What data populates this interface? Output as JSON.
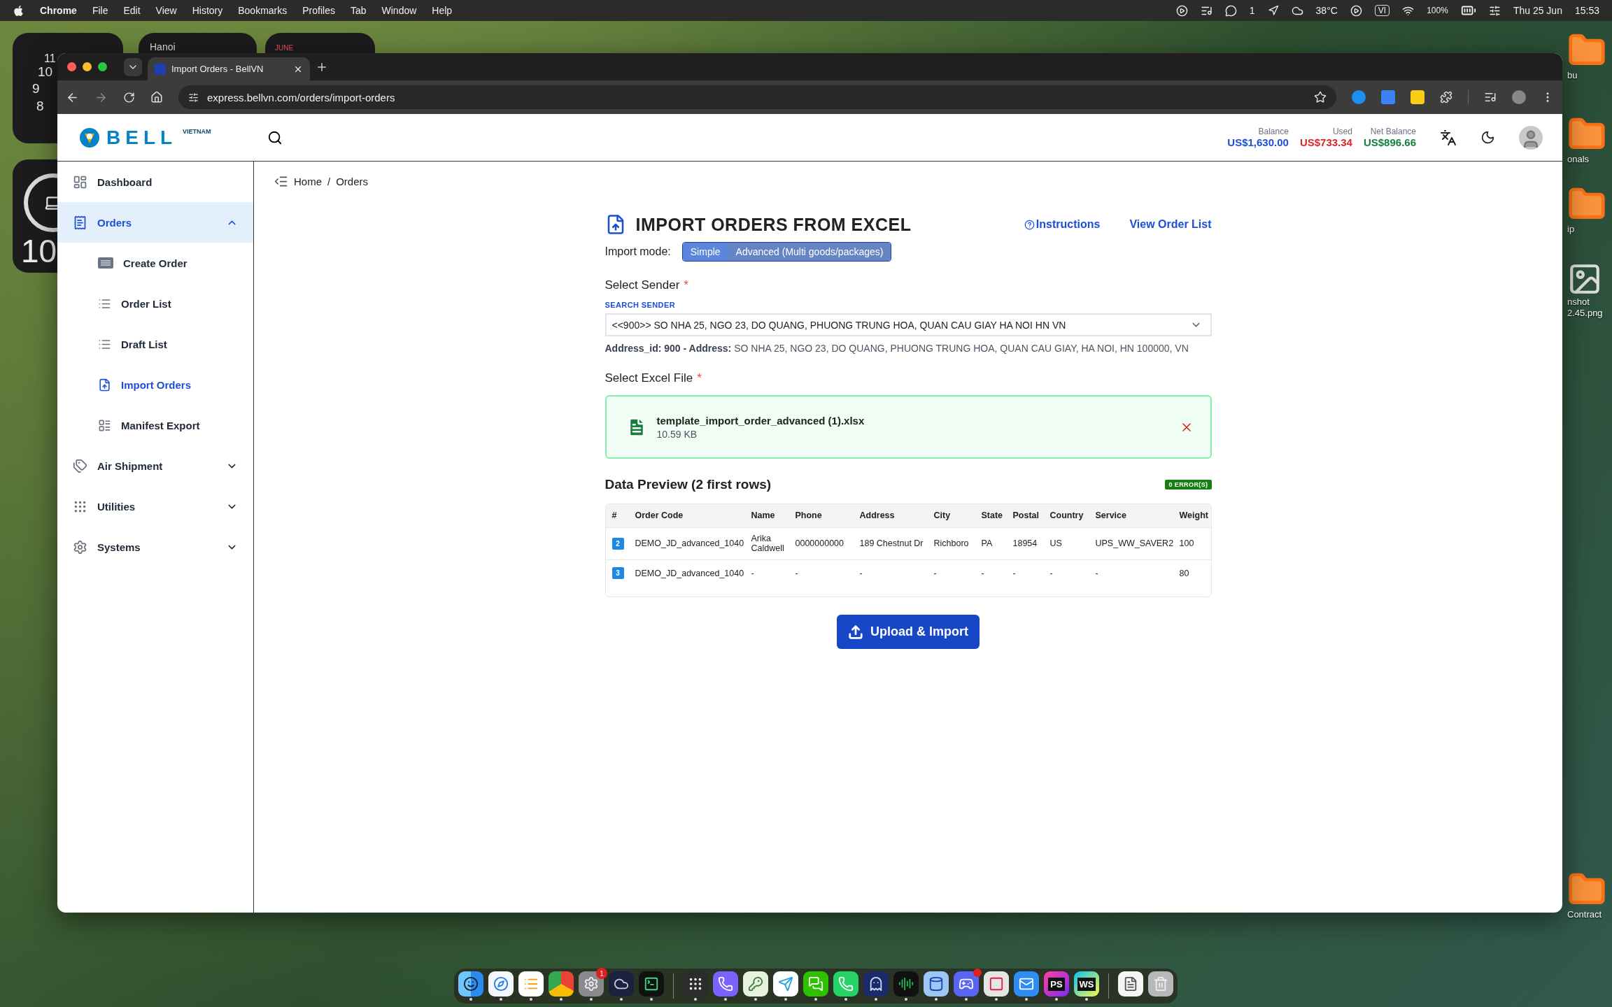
{
  "menu_bar": {
    "app": "Chrome",
    "menus": [
      "File",
      "Edit",
      "View",
      "History",
      "Bookmarks",
      "Profiles",
      "Tab",
      "Window",
      "Help"
    ],
    "chat_count": "1",
    "weather": "38°C",
    "input_source": "VI",
    "battery": "100%",
    "date": "Thu 25 Jun",
    "time": "15:53"
  },
  "desktop": {
    "clock_numerals": [
      "11",
      "10",
      "9",
      "8"
    ],
    "weather_city": "Hanoi",
    "calendar_month": "JUNE",
    "device_battery": "10",
    "icons": [
      {
        "kind": "folder",
        "lines": [
          "bu"
        ]
      },
      {
        "kind": "folder",
        "lines": [
          "onals"
        ]
      },
      {
        "kind": "folder",
        "lines": [
          "ip"
        ]
      },
      {
        "kind": "image",
        "lines": [
          "nshot",
          "2.45.png"
        ]
      },
      {
        "kind": "folder",
        "lines": [
          "Contract"
        ]
      }
    ]
  },
  "browser": {
    "tabs": [
      {
        "title": "Import Orders - BellVN",
        "selected": true
      }
    ],
    "url": "express.bellvn.com/orders/import-orders"
  },
  "app_header": {
    "logo": "BELL",
    "logo_sub": "VIETNAM",
    "balances": [
      {
        "label": "Balance",
        "value": "US$1,630.00",
        "color": "#1d4ed8"
      },
      {
        "label": "Used",
        "value": "US$733.34",
        "color": "#dc2626"
      },
      {
        "label": "Net Balance",
        "value": "US$896.66",
        "color": "#15803d"
      }
    ]
  },
  "sidebar": {
    "items": [
      {
        "label": "Dashboard",
        "selected": false
      },
      {
        "label": "Orders",
        "selected": true,
        "expanded": true,
        "children": [
          {
            "label": "Create Order",
            "selected": false
          },
          {
            "label": "Order List",
            "selected": false
          },
          {
            "label": "Draft List",
            "selected": false
          },
          {
            "label": "Import Orders",
            "selected": true
          },
          {
            "label": "Manifest Export",
            "selected": false
          }
        ]
      },
      {
        "label": "Air Shipment",
        "selected": false,
        "expanded": false
      },
      {
        "label": "Utilities",
        "selected": false,
        "expanded": false
      },
      {
        "label": "Systems",
        "selected": false,
        "expanded": false
      }
    ]
  },
  "breadcrumb": {
    "items": [
      "Home",
      "Orders"
    ],
    "separator": "/"
  },
  "page": {
    "title": "IMPORT ORDERS FROM EXCEL",
    "links": [
      "Instructions",
      "View Order List"
    ],
    "import_mode": {
      "label": "Import mode:",
      "options": [
        {
          "label": "Simple",
          "selected": false
        },
        {
          "label": "Advanced (Multi goods/packages)",
          "selected": true
        }
      ]
    },
    "sender": {
      "label": "Select Sender",
      "required_mark": "*",
      "search_label": "SEARCH SENDER",
      "value": "<<900>> SO NHA 25, NGO 23, DO QUANG, PHUONG TRUNG HOA, QUAN CAU GIAY HA NOI HN VN",
      "address_info": "**Address_id: 900 - Address:** SO NHA 25, NGO 23, DO QUANG, PHUONG TRUNG HOA, QUAN CAU GIAY, HA NOI, HN 100000, VN"
    },
    "file": {
      "label": "Select Excel File",
      "required_mark": "*",
      "name": "template_import_order_advanced (1).xlsx",
      "size": "10.59 KB"
    },
    "preview": {
      "title": "Data Preview (2 first rows)",
      "error_badge": "0 ERROR(S)",
      "columns": [
        "#",
        "Order Code",
        "Name",
        "Phone",
        "Address",
        "City",
        "State",
        "Postal",
        "Country",
        "Service",
        "Weight"
      ],
      "rows": [
        {
          "cells": [
            "2",
            "DEMO_JD_advanced_1040",
            "Arika Caldwell",
            "0000000000",
            "189 Chestnut Dr",
            "Richboro",
            "PA",
            "18954",
            "US",
            "UPS_WW_SAVER2",
            "100"
          ]
        },
        {
          "cells": [
            "3",
            "DEMO_JD_advanced_1040",
            "-",
            "-",
            "-",
            "-",
            "-",
            "-",
            "-",
            "-",
            "80"
          ]
        }
      ]
    },
    "submit": "Upload & Import"
  },
  "dock": {
    "groups": [
      [
        {
          "kind": "finder",
          "running": true,
          "alert": false
        },
        {
          "kind": "safari",
          "running": true,
          "alert": false
        },
        {
          "kind": "reminders",
          "running": true,
          "alert": false
        },
        {
          "kind": "chrome",
          "running": true,
          "alert": false
        },
        {
          "kind": "settings",
          "running": true,
          "alert": false,
          "badge": "1"
        },
        {
          "kind": "cloud",
          "running": true,
          "alert": false
        },
        {
          "kind": "terminal",
          "running": true,
          "alert": false
        }
      ],
      [
        {
          "kind": "launchpad",
          "running": true,
          "alert": false
        },
        {
          "kind": "viber",
          "running": true,
          "alert": false
        },
        {
          "kind": "key",
          "running": true,
          "alert": false
        },
        {
          "kind": "telegram",
          "running": true,
          "alert": false
        },
        {
          "kind": "wechat",
          "running": true,
          "alert": false
        },
        {
          "kind": "whatsapp",
          "running": true,
          "alert": false
        },
        {
          "kind": "ghost",
          "running": true,
          "alert": false
        },
        {
          "kind": "spotify",
          "running": true,
          "alert": false
        },
        {
          "kind": "lens",
          "running": true,
          "alert": false
        },
        {
          "kind": "discord",
          "running": true,
          "alert": true
        },
        {
          "kind": "redsquare",
          "running": true,
          "alert": false
        },
        {
          "kind": "mail",
          "running": true,
          "alert": false
        },
        {
          "kind": "ps",
          "running": true,
          "alert": false,
          "label": "PS"
        },
        {
          "kind": "ws",
          "running": true,
          "alert": false,
          "label": "WS"
        }
      ],
      [
        {
          "kind": "doc",
          "running": false,
          "alert": false
        },
        {
          "kind": "trash",
          "running": false,
          "alert": false
        }
      ]
    ]
  }
}
